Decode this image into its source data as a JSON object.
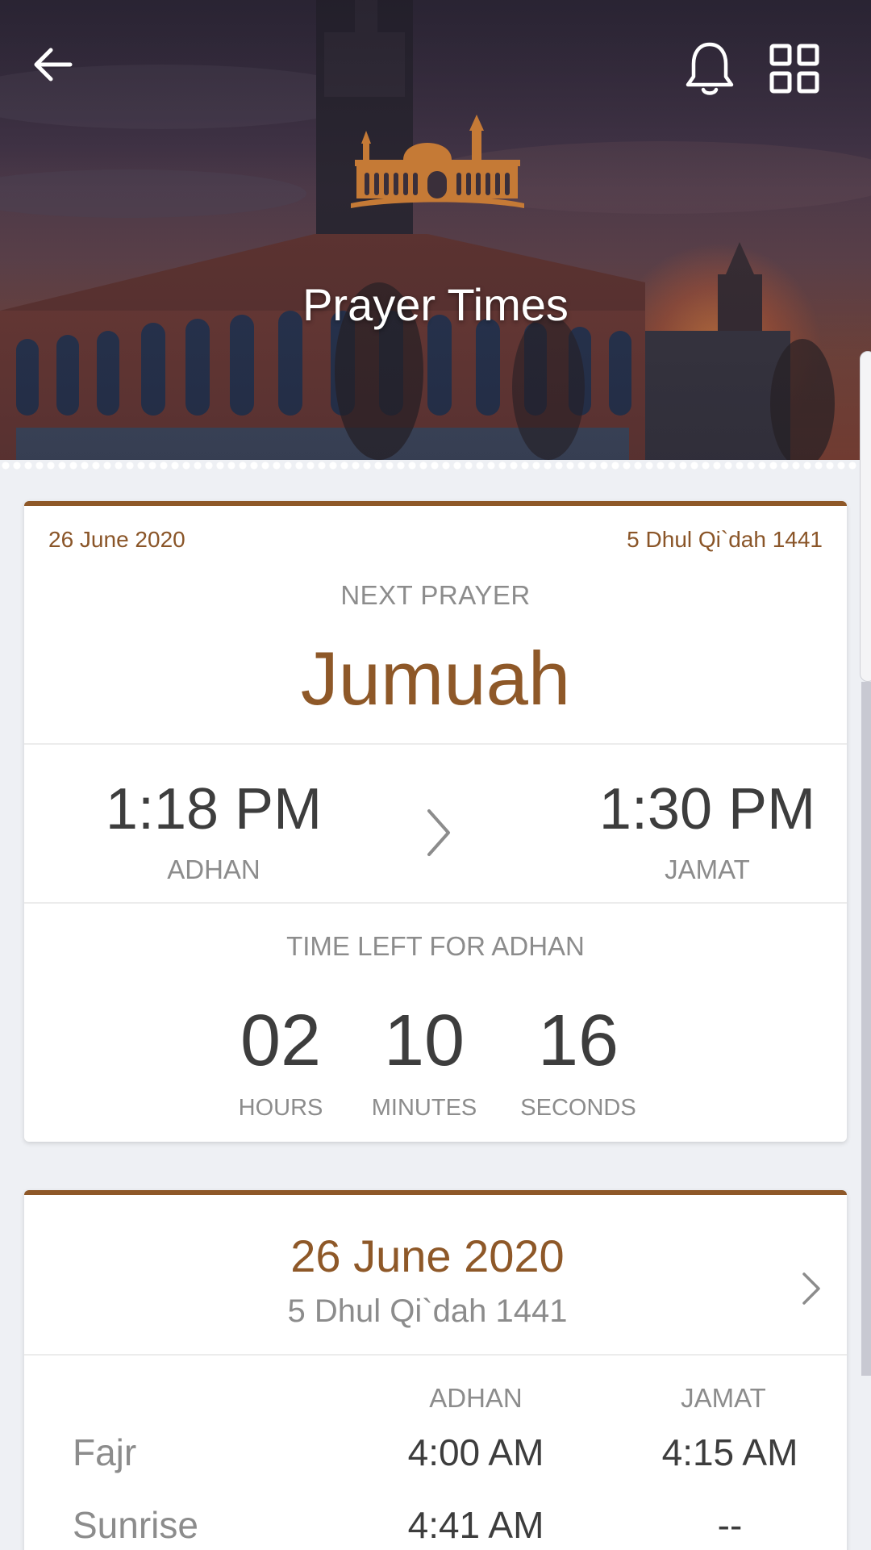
{
  "header": {
    "title": "Prayer Times",
    "icons": [
      "back-arrow-icon",
      "bell-icon",
      "grid-icon",
      "mosque-logo-icon"
    ]
  },
  "next_prayer_card": {
    "gregorian_date": "26 June 2020",
    "hijri_date": "5 Dhul Qi`dah 1441",
    "section_label": "NEXT PRAYER",
    "prayer_name": "Jumuah",
    "adhan_time": "1:18 PM",
    "adhan_label": "ADHAN",
    "jamat_time": "1:30 PM",
    "jamat_label": "JAMAT",
    "countdown_label": "TIME LEFT FOR ADHAN",
    "countdown": {
      "hours": "02",
      "hours_label": "HOURS",
      "minutes": "10",
      "minutes_label": "MINUTES",
      "seconds": "16",
      "seconds_label": "SECONDS"
    }
  },
  "timetable_card": {
    "gregorian_date": "26 June 2020",
    "hijri_date": "5 Dhul Qi`dah 1441",
    "columns": [
      "ADHAN",
      "JAMAT"
    ],
    "rows": [
      {
        "name": "Fajr",
        "adhan": "4:00 AM",
        "jamat": "4:15 AM"
      },
      {
        "name": "Sunrise",
        "adhan": "4:41 AM",
        "jamat": "--"
      }
    ]
  },
  "colors": {
    "accent": "#8e5828",
    "muted_text": "#8c8c8c",
    "dark_text": "#3d3d3d",
    "background": "#eef0f4"
  }
}
